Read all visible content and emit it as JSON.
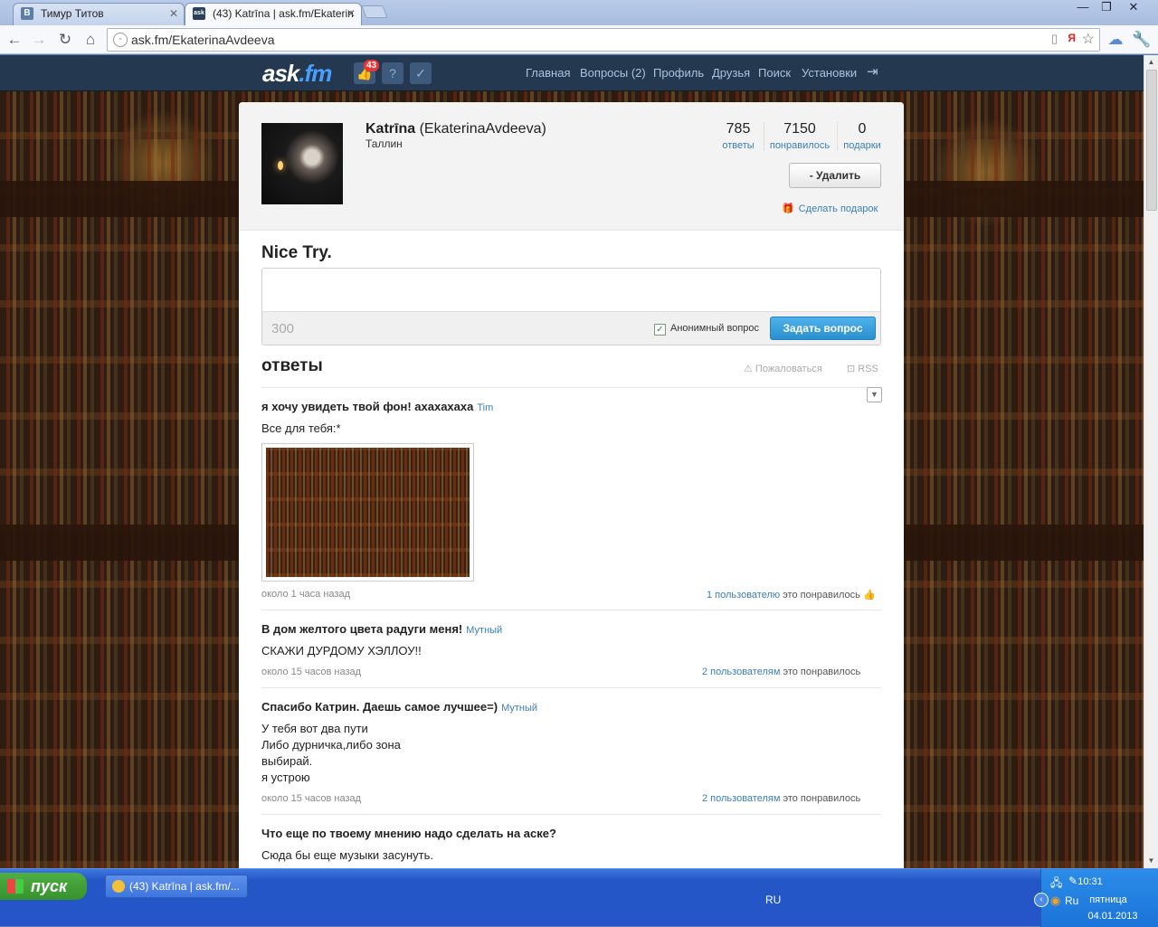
{
  "browser": {
    "tabs": [
      {
        "title": "Тимур Титов",
        "favicon": "В"
      },
      {
        "title": "(43) Katrīna | ask.fm/Ekaterin",
        "favicon": "ask"
      }
    ],
    "url": "ask.fm/EkaterinaAvdeeva"
  },
  "site": {
    "logo_main": "ask",
    "logo_tld": ".fm",
    "notifications_count": "43",
    "nav": [
      "Главная",
      "Вопросы (2)",
      "Профиль",
      "Друзья",
      "Поиск",
      "Установки"
    ]
  },
  "profile": {
    "display_name": "Katrīna",
    "username": "(EkaterinaAvdeeva)",
    "city": "Таллин",
    "stats": [
      {
        "value": "785",
        "label": "ответы"
      },
      {
        "value": "7150",
        "label": "понравилось"
      },
      {
        "value": "0",
        "label": "подарки"
      }
    ],
    "delete_button": "- Удалить",
    "gift_link": "Сделать подарок"
  },
  "ask": {
    "heading": "Nice Try.",
    "counter": "300",
    "anonymous_label": "Анонимный вопрос",
    "anonymous_checked": true,
    "submit": "Задать вопрос"
  },
  "answers": {
    "heading": "ответы",
    "report": "Пожаловаться",
    "rss": "RSS",
    "items": [
      {
        "question": "я хочу увидеть твой фон! ахахахаха",
        "author": "Tim",
        "answer": "Все для тебя:*",
        "time": "около 1 часа назад",
        "likes_link": "1 пользователю",
        "likes_text": " это понравилось"
      },
      {
        "question": "В дом желтого цвета радуги меня!",
        "author": "Мутный",
        "answer": "СКАЖИ ДУРДОМУ ХЭЛЛОУ!!",
        "time": "около 15 часов назад",
        "likes_link": "2 пользователям",
        "likes_text": " это понравилось"
      },
      {
        "question": "Спасибо Катрин. Даешь самое лучшее=)",
        "author": "Мутный",
        "answer": "У тебя вот два пути\nЛибо дурничка,либо зона\nвыбирай.\nя устрою",
        "time": "около 15 часов назад",
        "likes_link": "2 пользователям",
        "likes_text": " это понравилось"
      },
      {
        "question": "Что еще по твоему мнению надо сделать на аске?",
        "author": "",
        "answer": "Сюда бы еще музыки засунуть.",
        "time": "",
        "likes_link": "",
        "likes_text": ""
      }
    ]
  },
  "taskbar": {
    "start": "пуск",
    "window_title": "(43) Katrīna | ask.fm/...",
    "language": "RU",
    "tray_lang": "Ru",
    "time": "10:31",
    "weekday": "пятница",
    "date": "04.01.2013"
  }
}
